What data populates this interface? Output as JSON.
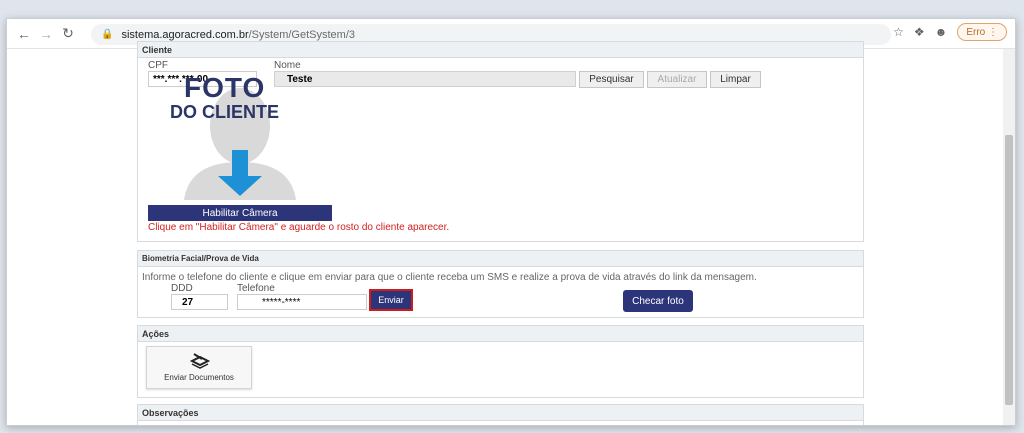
{
  "browser": {
    "url_host": "sistema.agoracred.com.br",
    "url_path": "/System/GetSystem/3",
    "error_label": "Erro",
    "icons": [
      "back-icon",
      "forward-icon",
      "reload-icon",
      "lock-icon",
      "star-icon",
      "puzzle-icon",
      "profile-icon",
      "menu-icon"
    ]
  },
  "cliente": {
    "header": "Cliente",
    "cpf_label": "CPF",
    "cpf_value": "***.***.***-00",
    "nome_label": "Nome",
    "nome_value": "Teste",
    "btn_pesquisar": "Pesquisar",
    "btn_atualizar": "Atualizar",
    "btn_limpar": "Limpar",
    "photo_title": "FOTO",
    "photo_sub": "DO CLIENTE",
    "btn_camera": "Habilitar Câmera",
    "camera_note": "Clique em \"Habilitar Câmera\" e aguarde o rosto do cliente aparecer."
  },
  "biometria": {
    "header": "Biometria Facial/Prova de Vida",
    "info": "Informe o telefone do cliente e clique em enviar para que o cliente receba um SMS e realize a prova de vida através do link da mensagem.",
    "ddd_label": "DDD",
    "ddd_value": "27",
    "telefone_label": "Telefone",
    "telefone_value": "*****-****",
    "btn_enviar": "Enviar",
    "btn_checar": "Checar foto"
  },
  "acoes": {
    "header": "Ações",
    "btn_enviar_docs": "Enviar Documentos"
  },
  "observacoes": {
    "header": "Observações"
  },
  "colors": {
    "primary": "#2c3579",
    "alert": "#d21f1f",
    "highlight_border": "#d11a1a"
  }
}
